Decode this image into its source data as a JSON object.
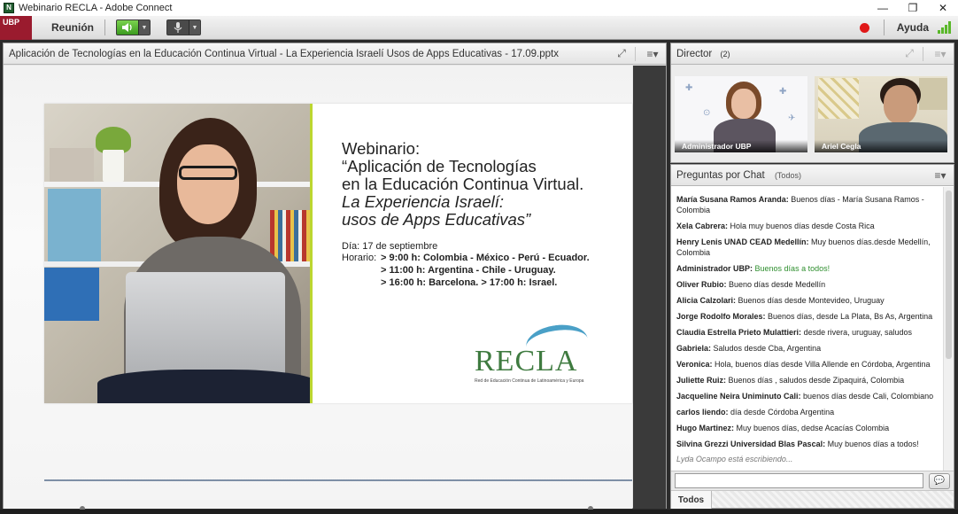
{
  "window": {
    "title": "Webinario RECLA - Adobe Connect",
    "minimize": "—",
    "restore": "❐",
    "close": "✕"
  },
  "menubar": {
    "logo": "UBP",
    "meeting_label": "Reunión",
    "help_label": "Ayuda",
    "colors": {
      "record": "#e01818",
      "audio": "#5ab82a"
    }
  },
  "share_pod": {
    "title": "Aplicación de Tecnologías en la Educación Continua Virtual - La Experiencia Israelí Usos de Apps Educativas - 17.09.pptx",
    "fullscreen_icon": "⤢",
    "menu_icon": "≡▾"
  },
  "slide": {
    "line1": "Webinario:",
    "line2": "“Aplicación de Tecnologías",
    "line3": "en la Educación Continua Virtual.",
    "line4": "La Experiencia Israelí:",
    "line5": "usos de Apps Educativas”",
    "date": "Día: 17 de septiembre",
    "schedule_label": "Horario:",
    "schedule": [
      "> 9:00 h: Colombia - México - Perú - Ecuador.",
      "> 11:00 h: Argentina - Chile - Uruguay.",
      "> 16:00 h: Barcelona. > 17:00 h: Israel."
    ],
    "logo_word": "RECLA",
    "logo_tagline": "Red de Educación Continua de Latinoamérica y Europa"
  },
  "director": {
    "title": "Director",
    "count": "(2)",
    "cameras": [
      {
        "name": "Administrador UBP"
      },
      {
        "name": "Ariel Cegla"
      }
    ]
  },
  "chat": {
    "title": "Preguntas por Chat",
    "scope": "(Todos)",
    "messages": [
      {
        "who": "María Susana Ramos Aranda:",
        "text": "Buenos días  -  María Susana Ramos - Colombia"
      },
      {
        "who": "Xela Cabrera:",
        "text": "Hola muy buenos días desde Costa Rica"
      },
      {
        "who": "Henry Lenis UNAD CEAD Medellín:",
        "text": "Muy buenos días.desde Medellín, Colombia"
      },
      {
        "who": "Administrador UBP:",
        "text": "Buenos días a todos!"
      },
      {
        "who": "Oliver Rubio:",
        "text": "Bueno días desde Medellín"
      },
      {
        "who": "Alicia Calzolari:",
        "text": "Buenos días desde Montevideo, Uruguay"
      },
      {
        "who": "Jorge Rodolfo Morales:",
        "text": "Buenos días, desde La Plata, Bs As, Argentina"
      },
      {
        "who": "Claudia Estrella Prieto Mulattieri:",
        "text": "desde rivera, uruguay, saludos"
      },
      {
        "who": "Gabriela:",
        "text": "Saludos desde Cba, Argentina"
      },
      {
        "who": "Veronica:",
        "text": "Hola, buenos días desde Villa Allende en Córdoba, Argentina"
      },
      {
        "who": "Juliette Ruiz:",
        "text": "Buenos días , saludos desde Zipaquirá, Colombia"
      },
      {
        "who": "Jacqueline Neira Uniminuto Cali:",
        "text": "buenos días desde Cali, Colombiano"
      },
      {
        "who": "carlos liendo:",
        "text": " día desde Córdoba Argentina"
      },
      {
        "who": "Hugo Martinez:",
        "text": "Muy buenos días, dedse Acacías Colombia"
      },
      {
        "who": "Silvina Grezzi Universidad Blas Pascal:",
        "text": "Muy buenos días a todos!"
      }
    ],
    "typing": "Lyda Ocampo está escribiendo...",
    "input_value": "",
    "send_icon": "💬",
    "footer_tab": "Todos"
  }
}
